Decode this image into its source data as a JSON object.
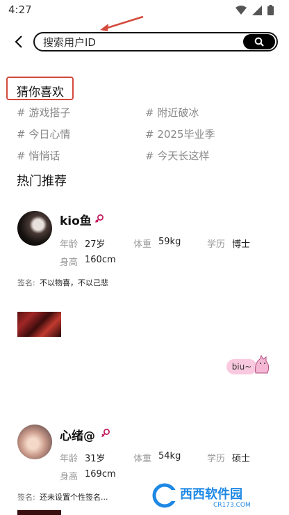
{
  "status_bar": {
    "time": "4:27",
    "icons": [
      "wifi-icon",
      "signal-icon",
      "battery-icon"
    ]
  },
  "search": {
    "placeholder": "搜索用户ID",
    "value": ""
  },
  "guess": {
    "title": "猜你喜欢",
    "tags": [
      "# 游戏搭子",
      "# 附近破冰",
      "# 今日心情",
      "# 2025毕业季",
      "# 悄悄话",
      "# 今天长这样"
    ]
  },
  "recommend": {
    "title": "热门推荐",
    "labels": {
      "age": "年龄",
      "weight": "体重",
      "edu": "学历",
      "height": "身高",
      "sig": "签名:"
    },
    "users": [
      {
        "name": "kio鱼",
        "age": "27岁",
        "weight": "59kg",
        "edu": "博士",
        "height": "160cm",
        "signature": "不以物喜，不以己悲"
      },
      {
        "name": "心绪@",
        "age": "31岁",
        "weight": "54kg",
        "edu": "硕士",
        "height": "169cm",
        "signature": "还未设置个性签名..."
      }
    ]
  },
  "sticker": {
    "bubble": "biu~"
  },
  "watermark": {
    "text": "西西软件园",
    "sub": "CR173.COM"
  },
  "colors": {
    "highlight_box": "#d4493c",
    "accent_pink": "#c2185b",
    "search_btn": "#000000"
  }
}
